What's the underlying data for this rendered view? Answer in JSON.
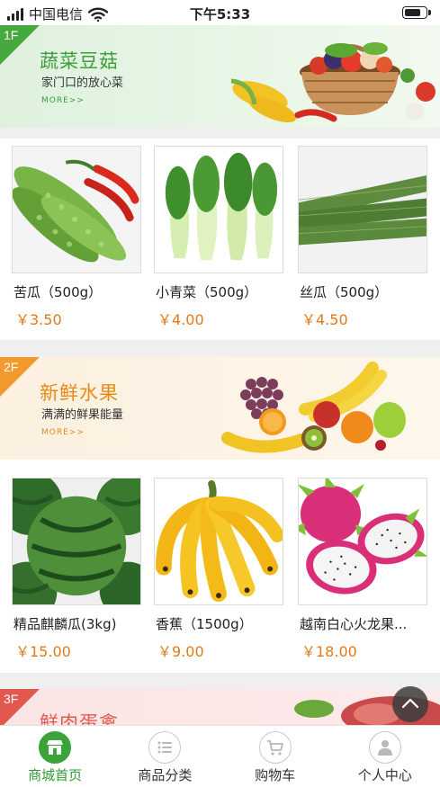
{
  "status_bar": {
    "carrier": "中国电信",
    "time": "下午5:33",
    "battery_level": 0.8
  },
  "floors": [
    {
      "tag": "1F",
      "title": "蔬菜豆菇",
      "subtitle": "家门口的放心菜",
      "more": "MORE>>",
      "accent": "#3d9d3b"
    },
    {
      "tag": "2F",
      "title": "新鲜水果",
      "subtitle": "满满的鲜果能量",
      "more": "MORE>>",
      "accent": "#e58a19"
    },
    {
      "tag": "3F",
      "title": "鲜肉蛋禽",
      "accent": "#e25a4f"
    }
  ],
  "products": [
    {
      "name": "苦瓜（500g）",
      "price": "￥3.50",
      "image": "bitter-melon"
    },
    {
      "name": "小青菜（500g）",
      "price": "￥4.00",
      "image": "bok-choy"
    },
    {
      "name": "丝瓜（500g）",
      "price": "￥4.50",
      "image": "luffa"
    },
    {
      "name": "精品麒麟瓜(3kg)",
      "price": "￥15.00",
      "image": "watermelon"
    },
    {
      "name": "香蕉（1500g）",
      "price": "￥9.00",
      "image": "banana"
    },
    {
      "name": "越南白心火龙果...",
      "price": "￥18.00",
      "image": "dragon-fruit"
    }
  ],
  "tabbar": [
    {
      "label": "商城首页",
      "icon": "store-icon",
      "active": true
    },
    {
      "label": "商品分类",
      "icon": "list-icon",
      "active": false
    },
    {
      "label": "购物车",
      "icon": "cart-icon",
      "active": false
    },
    {
      "label": "个人中心",
      "icon": "user-icon",
      "active": false
    }
  ],
  "colors": {
    "price": "#e07a1b",
    "tab_active": "#2f9a35"
  }
}
